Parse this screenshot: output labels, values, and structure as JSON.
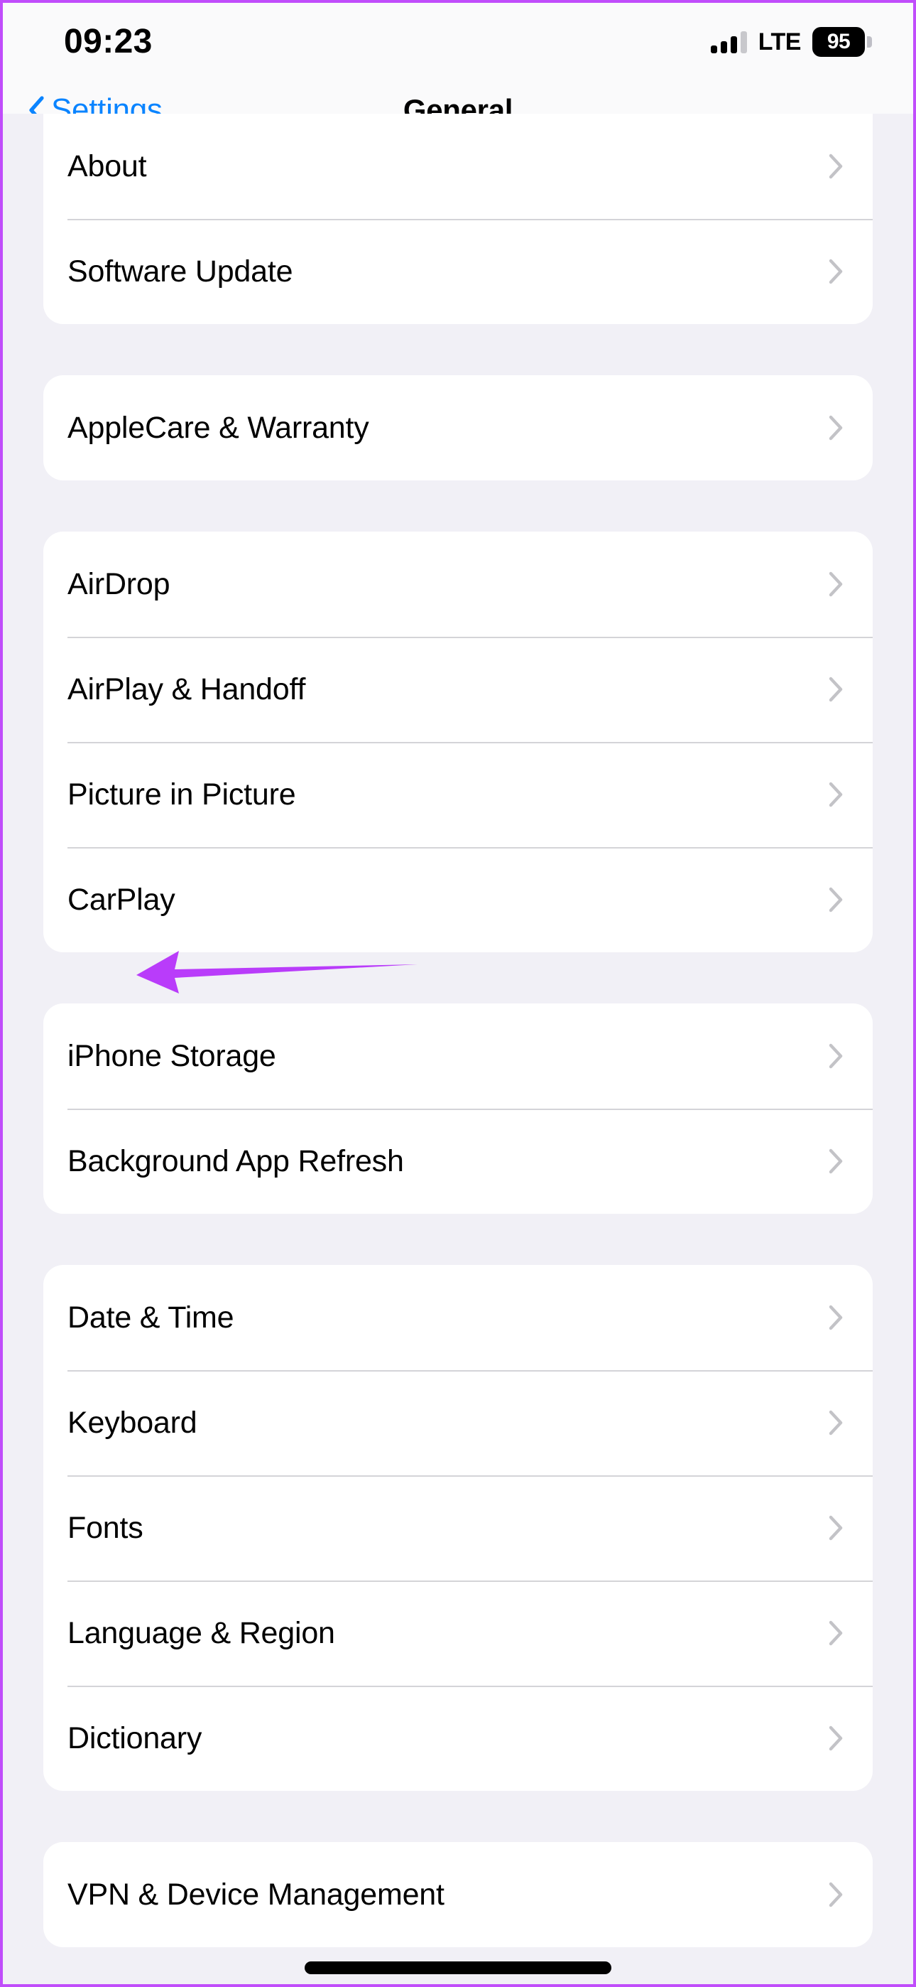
{
  "status_bar": {
    "time": "09:23",
    "carrier_label": "LTE",
    "battery_percent": "95",
    "signal_bars_total": 4,
    "signal_bars_filled": 3
  },
  "nav_bar": {
    "back_label": "Settings",
    "title": "General",
    "back_icon": "chevron-left-icon",
    "accent_color": "#0A84FF"
  },
  "colors": {
    "page_background": "#F1F0F6",
    "card_background": "#FFFFFF",
    "separator": "#D4D4D8",
    "chevron": "#C3C3C7",
    "annotation_purple": "#B93CFA",
    "frame_border": "#C04DFB"
  },
  "groups": [
    {
      "id": "group-about",
      "clipped_top": true,
      "rows": [
        {
          "label": "About",
          "accessory": "chevron-right-icon"
        },
        {
          "label": "Software Update",
          "accessory": "chevron-right-icon"
        }
      ]
    },
    {
      "id": "group-applecare",
      "clipped_top": false,
      "rows": [
        {
          "label": "AppleCare & Warranty",
          "accessory": "chevron-right-icon"
        }
      ]
    },
    {
      "id": "group-connectivity",
      "clipped_top": false,
      "rows": [
        {
          "label": "AirDrop",
          "accessory": "chevron-right-icon"
        },
        {
          "label": "AirPlay & Handoff",
          "accessory": "chevron-right-icon"
        },
        {
          "label": "Picture in Picture",
          "accessory": "chevron-right-icon"
        },
        {
          "label": "CarPlay",
          "accessory": "chevron-right-icon"
        }
      ]
    },
    {
      "id": "group-storage",
      "clipped_top": false,
      "rows": [
        {
          "label": "iPhone Storage",
          "accessory": "chevron-right-icon"
        },
        {
          "label": "Background App Refresh",
          "accessory": "chevron-right-icon"
        }
      ]
    },
    {
      "id": "group-localization",
      "clipped_top": false,
      "rows": [
        {
          "label": "Date & Time",
          "accessory": "chevron-right-icon"
        },
        {
          "label": "Keyboard",
          "accessory": "chevron-right-icon"
        },
        {
          "label": "Fonts",
          "accessory": "chevron-right-icon"
        },
        {
          "label": "Language & Region",
          "accessory": "chevron-right-icon"
        },
        {
          "label": "Dictionary",
          "accessory": "chevron-right-icon"
        }
      ]
    },
    {
      "id": "group-vpn",
      "clipped_top": false,
      "rows": [
        {
          "label": "VPN & Device Management",
          "accessory": "chevron-right-icon"
        }
      ]
    }
  ],
  "annotation": {
    "type": "arrow",
    "direction": "left",
    "points_at": "CarPlay",
    "color": "#B93CFA"
  }
}
